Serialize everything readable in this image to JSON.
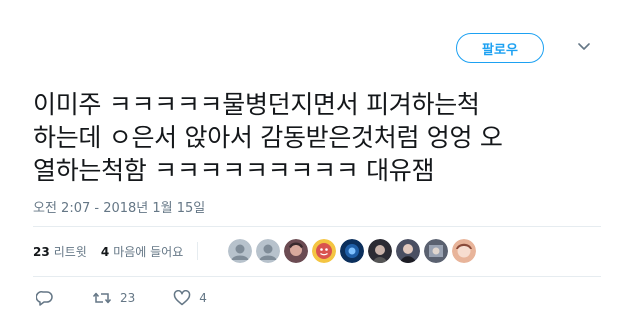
{
  "follow_button": {
    "label": "팔로우"
  },
  "tweet": {
    "text": "이미주 ㅋㅋㅋㅋㅋ물병던지면서 피겨하는척\n하는데 ㅇ은서 앉아서 감동받은것처럼 엉엉 오\n열하는척함 ㅋㅋㅋㅋㅋㅋㅋㅋㅋ 대유잼",
    "timestamp": "오전 2:07 - 2018년 1월 15일"
  },
  "stats": {
    "retweets_count": "23",
    "retweets_label": "리트윗",
    "likes_count": "4",
    "likes_label": "마음에 들어요"
  },
  "avatars": [
    {
      "name": "avatar-default-1",
      "color": "#b7c2cc"
    },
    {
      "name": "avatar-default-2",
      "color": "#b7c2cc"
    },
    {
      "name": "avatar-photo-1",
      "color": "#6b4b52"
    },
    {
      "name": "avatar-photo-2",
      "color": "#d9534f"
    },
    {
      "name": "avatar-photo-3",
      "color": "#0b2f5c"
    },
    {
      "name": "avatar-photo-4",
      "color": "#2b2b33"
    },
    {
      "name": "avatar-photo-5",
      "color": "#4a4f62"
    },
    {
      "name": "avatar-photo-6",
      "color": "#5a6170"
    },
    {
      "name": "avatar-photo-7",
      "color": "#e8b49a"
    }
  ],
  "actions": {
    "reply_icon": "reply-icon",
    "retweet_icon": "retweet-icon",
    "retweet_count": "23",
    "like_icon": "heart-icon",
    "like_count": "4"
  },
  "colors": {
    "accent": "#1da1f2",
    "muted": "#657786",
    "text": "#14171a"
  }
}
